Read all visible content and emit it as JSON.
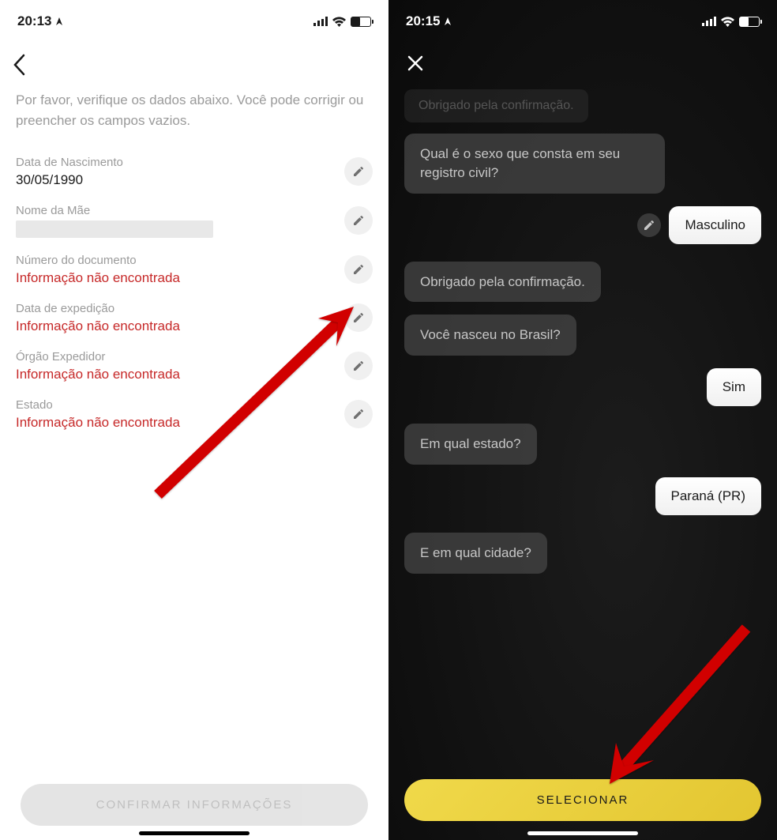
{
  "left": {
    "status_time": "20:13",
    "instruction": "Por favor, verifique os dados abaixo. Você pode corrigir ou preencher os campos vazios.",
    "fields": [
      {
        "label": "Data de Nascimento",
        "value": "30/05/1990",
        "error": false,
        "redacted": false
      },
      {
        "label": "Nome da Mãe",
        "value": "",
        "error": false,
        "redacted": true
      },
      {
        "label": "Número do documento",
        "value": "Informação não encontrada",
        "error": true,
        "redacted": false
      },
      {
        "label": "Data de expedição",
        "value": "Informação não encontrada",
        "error": true,
        "redacted": false
      },
      {
        "label": "Órgão Expedidor",
        "value": "Informação não encontrada",
        "error": true,
        "redacted": false
      },
      {
        "label": "Estado",
        "value": "Informação não encontrada",
        "error": true,
        "redacted": false
      }
    ],
    "confirm_label": "CONFIRMAR INFORMAÇÕES"
  },
  "right": {
    "status_time": "20:15",
    "faded_msg": "Obrigado pela confirmação.",
    "messages": [
      {
        "type": "bot",
        "text": "Qual é o sexo que consta em seu registro civil?"
      },
      {
        "type": "user",
        "text": "Masculino",
        "editable": true
      },
      {
        "type": "bot",
        "text": "Obrigado pela confirmação."
      },
      {
        "type": "bot",
        "text": "Você nasceu no Brasil?"
      },
      {
        "type": "user",
        "text": "Sim",
        "editable": false
      },
      {
        "type": "bot",
        "text": "Em qual estado?"
      },
      {
        "type": "user",
        "text": "Paraná (PR)",
        "editable": false
      },
      {
        "type": "bot",
        "text": "E em qual cidade?"
      }
    ],
    "select_label": "SELECIONAR"
  }
}
